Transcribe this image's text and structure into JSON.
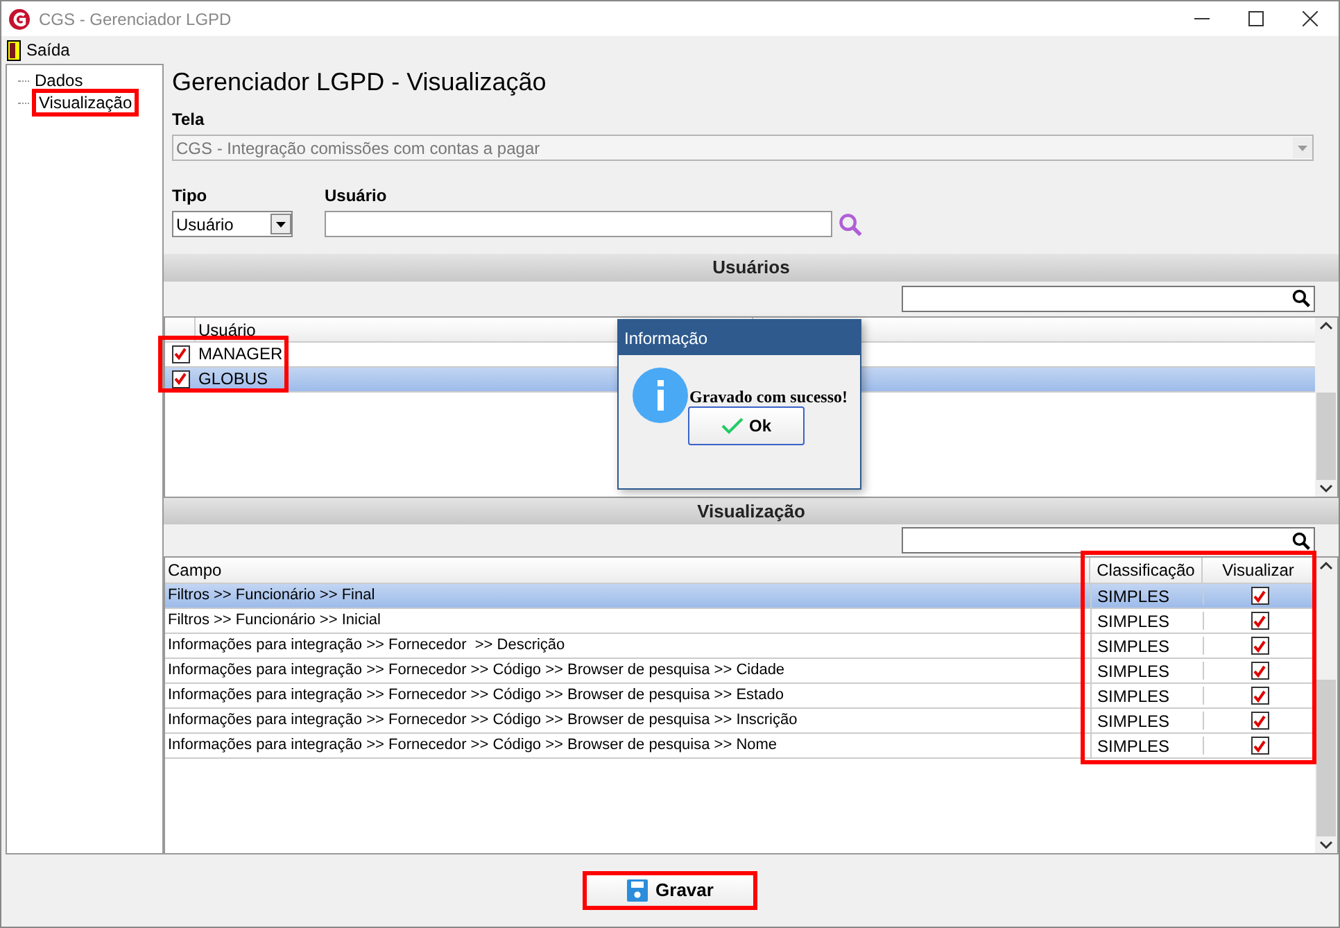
{
  "window": {
    "title": "CGS - Gerenciador LGPD"
  },
  "menu": [
    {
      "label": "Saída"
    }
  ],
  "tree": [
    {
      "label": "Dados",
      "highlighted": false
    },
    {
      "label": "Visualização",
      "highlighted": true
    }
  ],
  "page_title": "Gerenciador LGPD - Visualização",
  "tela": {
    "label": "Tela",
    "value": "CGS - Integração comissões com contas a pagar",
    "disabled": true
  },
  "tipo": {
    "label": "Tipo",
    "value": "Usuário"
  },
  "usuario": {
    "label": "Usuário"
  },
  "users_section": {
    "title": "Usuários",
    "highlighted": true,
    "columns": [
      "Usuário"
    ],
    "rows": [
      {
        "name": "MANAGER",
        "checked": true,
        "selected": false
      },
      {
        "name": "GLOBUS",
        "checked": true,
        "selected": true
      }
    ]
  },
  "view_section": {
    "title": "Visualização",
    "columns": [
      {
        "label": "Campo"
      },
      {
        "label": "Classificação"
      },
      {
        "label": "Visualizar"
      }
    ],
    "last_columns_highlighted": true,
    "rows": [
      {
        "campo": "Filtros >> Funcionário >> Final",
        "classificacao": "SIMPLES",
        "visualizar": true,
        "selected": true
      },
      {
        "campo": "Filtros >> Funcionário >> Inicial",
        "classificacao": "SIMPLES",
        "visualizar": true,
        "selected": false
      },
      {
        "campo": "Informações para integração >> Fornecedor  >> Descrição",
        "classificacao": "SIMPLES",
        "visualizar": true,
        "selected": false
      },
      {
        "campo": "Informações para integração >> Fornecedor >> Código >> Browser de pesquisa >> Cidade",
        "classificacao": "SIMPLES",
        "visualizar": true,
        "selected": false
      },
      {
        "campo": "Informações para integração >> Fornecedor >> Código >> Browser de pesquisa >> Estado",
        "classificacao": "SIMPLES",
        "visualizar": true,
        "selected": false
      },
      {
        "campo": "Informações para integração >> Fornecedor >> Código >> Browser de pesquisa >> Inscrição",
        "classificacao": "SIMPLES",
        "visualizar": true,
        "selected": false
      },
      {
        "campo": "Informações para integração >> Fornecedor >> Código >> Browser de pesquisa >> Nome",
        "classificacao": "SIMPLES",
        "visualizar": true,
        "selected": false
      }
    ]
  },
  "save_button": {
    "label": "Gravar",
    "highlighted": true
  },
  "dialog": {
    "title": "Informação",
    "message": "Gravado com sucesso!",
    "button": "Ok"
  }
}
